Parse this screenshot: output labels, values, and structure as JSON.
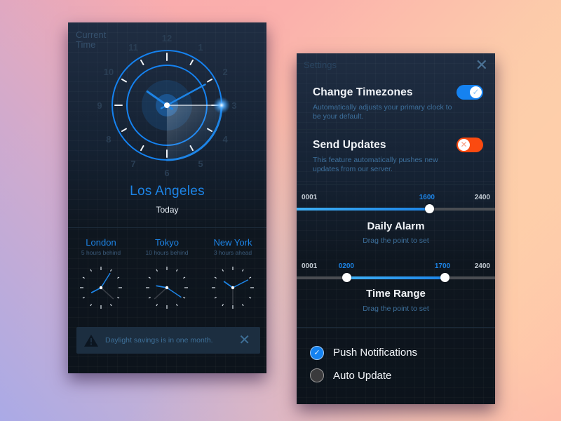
{
  "colors": {
    "accent": "#1d84e6",
    "toggle_on": "#1582f0",
    "toggle_off": "#fa4a10",
    "panel_top": "#1f2d42",
    "panel_bottom": "#0c131b"
  },
  "current_time_panel": {
    "label": "Current Time",
    "main_clock": {
      "dial_numbers": [
        "12",
        "1",
        "2",
        "3",
        "4",
        "5",
        "6",
        "7",
        "8",
        "9",
        "10",
        "11"
      ],
      "time": {
        "hour": 10,
        "minute": 10,
        "second": 15
      }
    },
    "city": "Los Angeles",
    "day": "Today",
    "world_clocks": [
      {
        "city": "London",
        "offset": "5 hours behind",
        "time": {
          "hour": 8,
          "minute": 5,
          "second": 22
        }
      },
      {
        "city": "Tokyo",
        "offset": "10 hours behind",
        "time": {
          "hour": 9,
          "minute": 20,
          "second": 38
        }
      },
      {
        "city": "New York",
        "offset": "3 hours ahead",
        "time": {
          "hour": 10,
          "minute": 10,
          "second": 30
        }
      }
    ],
    "alert": {
      "icon": "warning-icon",
      "message": "Daylight savings is in one month.",
      "close_icon": "close-icon",
      "close_glyph": "✕"
    }
  },
  "settings_panel": {
    "title": "Settings",
    "close_glyph": "✕",
    "options": [
      {
        "title": "Change Timezones",
        "description": "Automatically adjusts your primary clock to be your default.",
        "enabled": true,
        "glyph": "✓"
      },
      {
        "title": "Send Updates",
        "description": "This feature automatically pushes new updates from our server.",
        "enabled": false,
        "glyph": "✕"
      }
    ],
    "daily_alarm": {
      "min_label": "0001",
      "max_label": "2400",
      "value_label": "1600",
      "value_fraction": 0.667,
      "title": "Daily Alarm",
      "hint": "Drag the point to set"
    },
    "time_range": {
      "min_label": "0001",
      "max_label": "2400",
      "start_label": "0200",
      "end_label": "1700",
      "start_fraction": 0.25,
      "end_fraction": 0.745,
      "title": "Time Range",
      "hint": "Drag the point to set"
    },
    "checkboxes": [
      {
        "label": "Push Notifications",
        "checked": true,
        "glyph": "✓"
      },
      {
        "label": "Auto Update",
        "checked": false,
        "glyph": ""
      }
    ]
  }
}
